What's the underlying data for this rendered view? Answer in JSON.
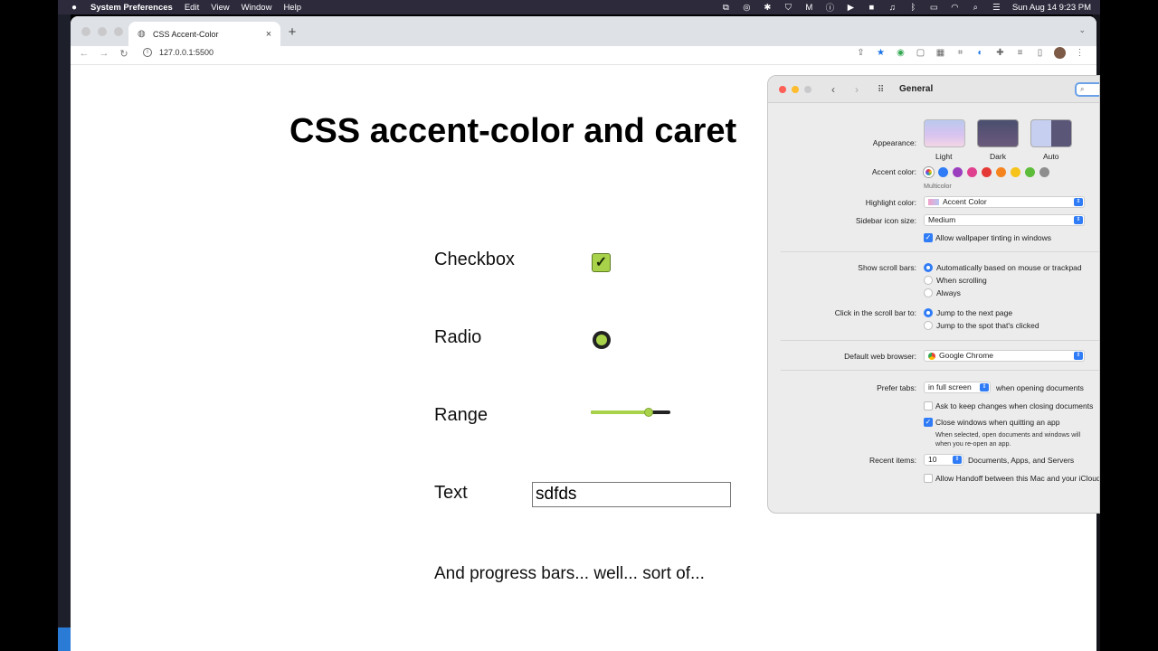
{
  "menubar": {
    "app_name": "System Preferences",
    "items": [
      "Edit",
      "View",
      "Window",
      "Help"
    ],
    "clock": "Sun Aug 14  9:23 PM"
  },
  "browser": {
    "tab_title": "CSS Accent-Color",
    "url": "127.0.0.1:5500"
  },
  "page": {
    "heading": "CSS accent-color and caret",
    "checkbox_label": "Checkbox",
    "radio_label": "Radio",
    "range_label": "Range",
    "range_value_fraction": 0.73,
    "text_label": "Text",
    "text_value": "sdfds",
    "progress_text": "And progress bars... well... sort of...",
    "accent_color": "#a8d24a"
  },
  "prefs": {
    "title": "General",
    "appearance_label": "Appearance:",
    "appearance_options": [
      "Light",
      "Dark",
      "Auto"
    ],
    "accent_label": "Accent color:",
    "accent_selected": "Multicolor",
    "accent_colors": [
      "#2f7cf6",
      "#9b3fbf",
      "#e0418e",
      "#e53935",
      "#f5841f",
      "#f6c31b",
      "#5ebc3b",
      "#8e8e8e"
    ],
    "highlight_label": "Highlight color:",
    "highlight_value": "Accent Color",
    "sidebar_label": "Sidebar icon size:",
    "sidebar_value": "Medium",
    "wallpaper_tint": "Allow wallpaper tinting in windows",
    "scroll_label": "Show scroll bars:",
    "scroll_options": [
      "Automatically based on mouse or trackpad",
      "When scrolling",
      "Always"
    ],
    "click_label": "Click in the scroll bar to:",
    "click_options": [
      "Jump to the next page",
      "Jump to the spot that's clicked"
    ],
    "browser_label": "Default web browser:",
    "browser_value": "Google Chrome",
    "tabs_label": "Prefer tabs:",
    "tabs_value": "in full screen",
    "tabs_suffix": "when opening documents",
    "ask_changes": "Ask to keep changes when closing documents",
    "close_windows": "Close windows when quitting an app",
    "close_note_1": "When selected, open documents and windows will",
    "close_note_2": "when you re-open an app.",
    "recent_label": "Recent items:",
    "recent_value": "10",
    "recent_suffix": "Documents, Apps, and Servers",
    "handoff": "Allow Handoff between this Mac and your iCloud devices"
  }
}
